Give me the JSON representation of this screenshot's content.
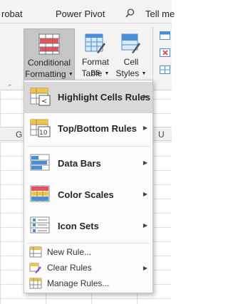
{
  "ribbon": {
    "tabs": [
      "robat",
      "Power Pivot",
      "Tell me"
    ],
    "buttons": {
      "conditional": {
        "line1": "Conditional",
        "line2": "Formatting"
      },
      "format_table": {
        "line1": "Format as",
        "line2": "Table"
      },
      "cell_styles": {
        "line1": "Cell",
        "line2": "Styles"
      }
    }
  },
  "sheet": {
    "columns": [
      "G",
      "U"
    ]
  },
  "menu": {
    "items": [
      {
        "label": "Highlight Cells Rules",
        "icon": "highlight-cells-icon",
        "submenu": true
      },
      {
        "label": "Top/Bottom Rules",
        "icon": "top-bottom-icon",
        "submenu": true
      },
      {
        "label": "Data Bars",
        "icon": "data-bars-icon",
        "submenu": true
      },
      {
        "label": "Color Scales",
        "icon": "color-scales-icon",
        "submenu": true
      },
      {
        "label": "Icon Sets",
        "icon": "icon-sets-icon",
        "submenu": true
      },
      {
        "label": "New Rule...",
        "icon": "new-rule-icon",
        "submenu": false
      },
      {
        "label": "Clear Rules",
        "icon": "clear-rules-icon",
        "submenu": true
      },
      {
        "label": "Manage Rules...",
        "icon": "manage-rules-icon",
        "submenu": false
      }
    ]
  },
  "colors": {
    "selected_button": "#c5c5c5",
    "highlight_item": "#d9d9d9",
    "icon_red": "#e8505b",
    "icon_blue": "#4a8fd6",
    "icon_yellow": "#f5c342"
  }
}
